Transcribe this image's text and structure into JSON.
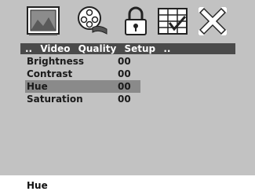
{
  "toolbar": {
    "icons": [
      "picture-icon",
      "film-reel-icon",
      "padlock-icon",
      "grid-settings-icon",
      "close-x-icon"
    ]
  },
  "tabs": {
    "lead": "..",
    "video": "Video",
    "quality": "Quality",
    "setup": "Setup",
    "trail": ".."
  },
  "settings": [
    {
      "label": "Brightness",
      "value": "00"
    },
    {
      "label": "Contrast",
      "value": "00"
    },
    {
      "label": "Hue",
      "value": "00"
    },
    {
      "label": "Saturation",
      "value": "00"
    }
  ],
  "selected_index": 2,
  "status_text": "Hue",
  "colors": {
    "panel_bg": "#c2c2c2",
    "tab_bg": "#4a4a4a",
    "selected_bg": "#8a8a8a"
  }
}
